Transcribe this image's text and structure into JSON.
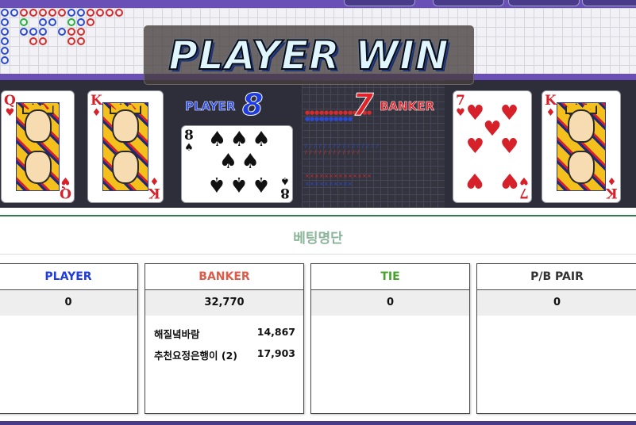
{
  "result": {
    "banner": "PLAYER WIN",
    "player_label": "PLAYER",
    "player_score": "8",
    "banker_label": "BANKER",
    "banker_score": "7"
  },
  "cards": {
    "player": [
      {
        "rank": "Q",
        "suit": "♥",
        "color": "red"
      },
      {
        "rank": "K",
        "suit": "♦",
        "color": "red"
      },
      {
        "rank": "8",
        "suit": "♠",
        "color": "black"
      }
    ],
    "banker": [
      {
        "rank": "7",
        "suit": "♥",
        "color": "red"
      },
      {
        "rank": "K",
        "suit": "♦",
        "color": "red"
      }
    ]
  },
  "betting_list": {
    "title": "베팅명단",
    "columns": [
      {
        "label": "PLAYER",
        "color": "#1f3ce0",
        "total": "0",
        "entries": []
      },
      {
        "label": "BANKER",
        "color": "#e05a48",
        "total": "32,770",
        "entries": [
          {
            "name": "해질녘바람",
            "amount": "14,867"
          },
          {
            "name": "추천요정은행이 (2)",
            "amount": "17,903"
          }
        ]
      },
      {
        "label": "TIE",
        "color": "#44a52a",
        "total": "0",
        "entries": []
      },
      {
        "label": "P/B PAIR",
        "color": "#333333",
        "total": "0",
        "entries": []
      }
    ]
  },
  "colors": {
    "player": "#1f3ce0",
    "banker": "#e0242a",
    "tie": "#27b13a",
    "accent_bar": "#6a4fb6"
  }
}
